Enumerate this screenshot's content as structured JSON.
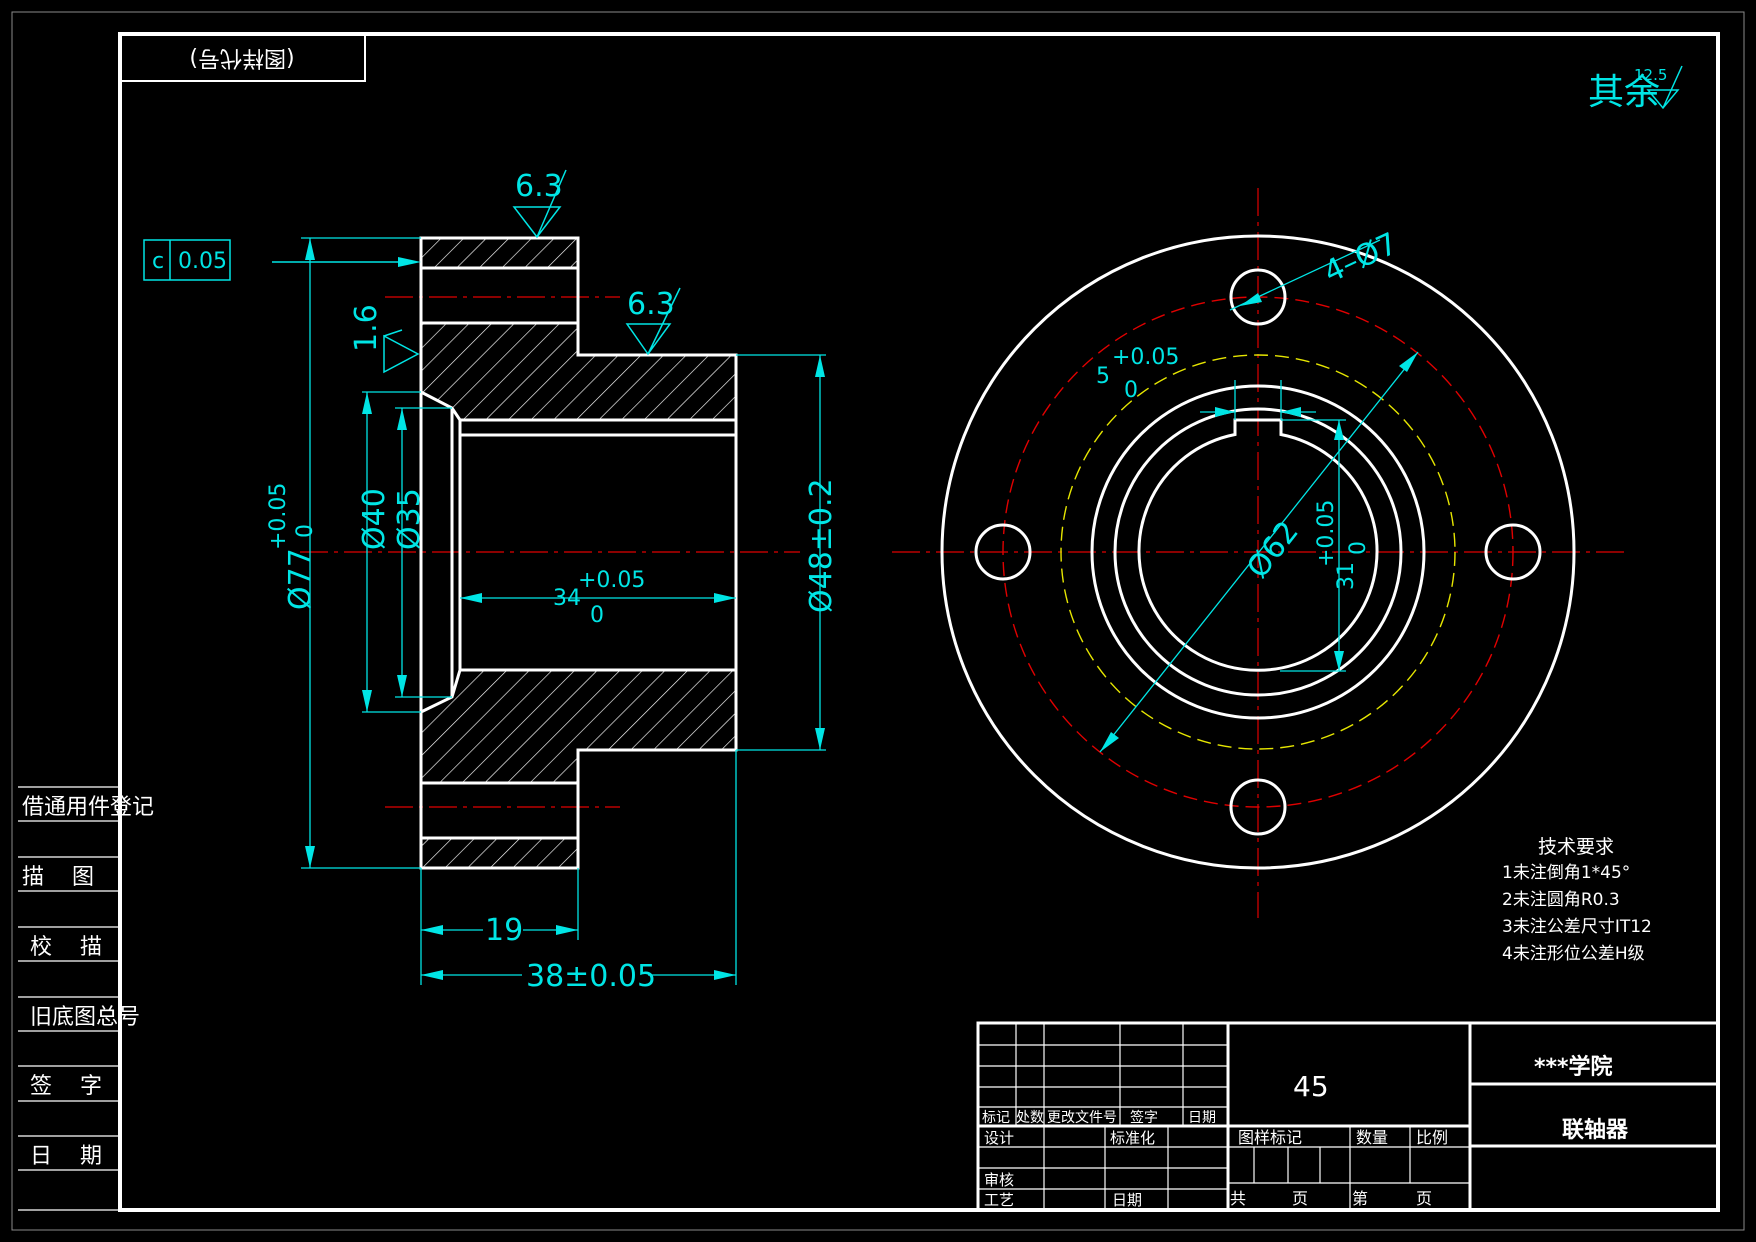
{
  "colors": {
    "background": "#000000",
    "outline": "#ffffff",
    "dimension": "#00e5e5",
    "centerline": "#e00000",
    "pitch_circle": "#e6e600"
  },
  "corner_box": {
    "text": "(图样代号)"
  },
  "surface_finish": {
    "prefix": "其余",
    "value": "12.5"
  },
  "side_view": {
    "roughness_top": "6.3",
    "roughness_mid": "6.3",
    "roughness_chamfer": "1.6",
    "tolerance_frame": {
      "symbol": "c",
      "value": "0.05"
    },
    "dim_outer": {
      "base": "Ø77",
      "upper": "+0.05",
      "lower": "0"
    },
    "dim_bore_40": "Ø40",
    "dim_bore_35": "Ø35",
    "dim_hub_len": {
      "base": "34",
      "upper": "+0.05",
      "lower": "0"
    },
    "dim_hub_dia": "Ø48±0.2",
    "dim_19": "19",
    "dim_38": "38±0.05"
  },
  "front_view": {
    "holes": "4–Ø7",
    "pcd": "Ø62",
    "keyway_width": {
      "base": "5",
      "upper": "+0.05",
      "lower": "0"
    },
    "keyway_depth": {
      "base": "31",
      "upper": "+0.05",
      "lower": "0"
    }
  },
  "tech_notes": {
    "title": "技术要求",
    "items": [
      "1未注倒角1*45°",
      "2未注圆角R0.3",
      "3未注公差尺寸IT12",
      "4未注形位公差H级"
    ]
  },
  "left_strip": [
    {
      "label": "借通用件登记"
    },
    {
      "label": "描    图"
    },
    {
      "label": "校    描"
    },
    {
      "label": "旧底图总号"
    },
    {
      "label": "签    字"
    },
    {
      "label": "日    期"
    }
  ],
  "title_block": {
    "material": "45",
    "institute": "***学院",
    "part_name": "联轴器",
    "rev_labels": [
      "标记",
      "处数",
      "更改文件号",
      "签字",
      "日期"
    ],
    "design": "设计",
    "standardization": "标准化",
    "review": "审核",
    "process": "工艺",
    "date": "日期",
    "sample_mark": "图样标记",
    "quantity": "数量",
    "scale": "比例",
    "total": "共",
    "sheet_unit": "页",
    "sheet_no": "第",
    "sheet_unit_2": "页"
  }
}
